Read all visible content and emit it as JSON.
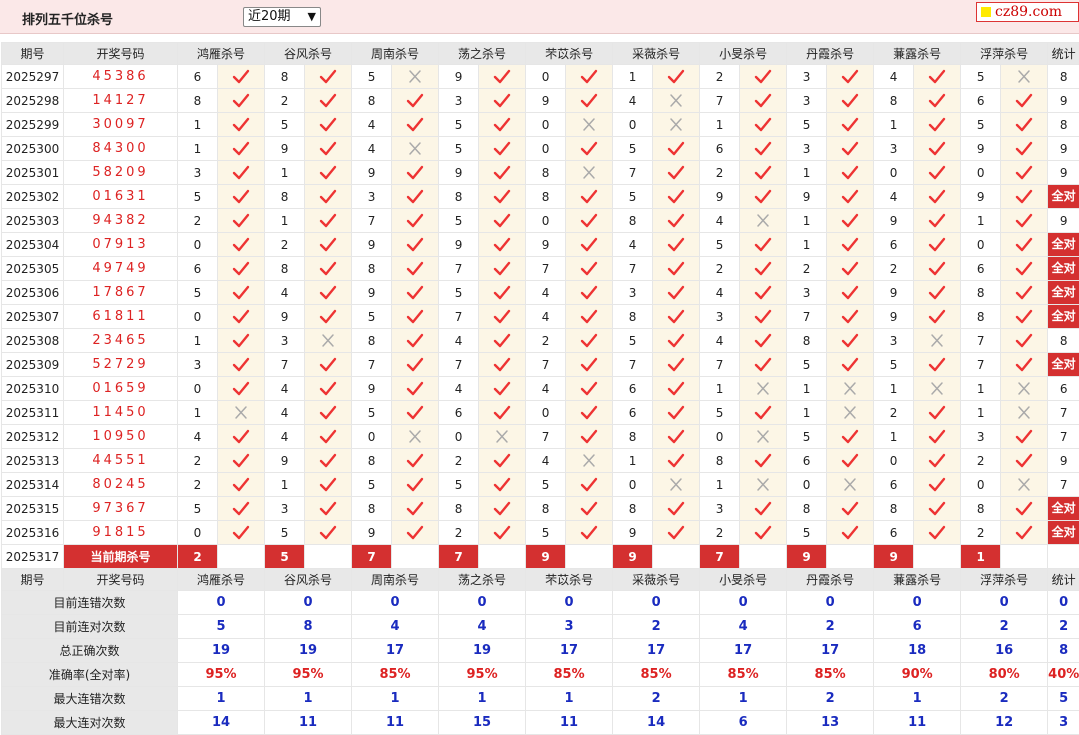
{
  "page_title": "排列五千位杀号",
  "period_select": {
    "value": "近20期",
    "options": [
      "近20期"
    ]
  },
  "logo_text": "cz89.com",
  "headers": [
    "期号",
    "开奖号码",
    "鸿雁杀号",
    "谷风杀号",
    "周南杀号",
    "荡之杀号",
    "芣苡杀号",
    "采薇杀号",
    "小旻杀号",
    "丹霞杀号",
    "蒹露杀号",
    "浮萍杀号",
    "统计"
  ],
  "all_correct_label": "全对",
  "current_label": "当前期杀号",
  "rows": [
    {
      "issue": "2025297",
      "code": "45386",
      "kills": [
        [
          6,
          1
        ],
        [
          8,
          1
        ],
        [
          5,
          0
        ],
        [
          9,
          1
        ],
        [
          0,
          1
        ],
        [
          1,
          1
        ],
        [
          2,
          1
        ],
        [
          3,
          1
        ],
        [
          4,
          1
        ],
        [
          5,
          0
        ]
      ],
      "total": "8"
    },
    {
      "issue": "2025298",
      "code": "14127",
      "kills": [
        [
          8,
          1
        ],
        [
          2,
          1
        ],
        [
          8,
          1
        ],
        [
          3,
          1
        ],
        [
          9,
          1
        ],
        [
          4,
          0
        ],
        [
          7,
          1
        ],
        [
          3,
          1
        ],
        [
          8,
          1
        ],
        [
          6,
          1
        ]
      ],
      "total": "9"
    },
    {
      "issue": "2025299",
      "code": "30097",
      "kills": [
        [
          1,
          1
        ],
        [
          5,
          1
        ],
        [
          4,
          1
        ],
        [
          5,
          1
        ],
        [
          0,
          0
        ],
        [
          0,
          0
        ],
        [
          1,
          1
        ],
        [
          5,
          1
        ],
        [
          1,
          1
        ],
        [
          5,
          1
        ]
      ],
      "total": "8"
    },
    {
      "issue": "2025300",
      "code": "84300",
      "kills": [
        [
          1,
          1
        ],
        [
          9,
          1
        ],
        [
          4,
          0
        ],
        [
          5,
          1
        ],
        [
          0,
          1
        ],
        [
          5,
          1
        ],
        [
          6,
          1
        ],
        [
          3,
          1
        ],
        [
          3,
          1
        ],
        [
          9,
          1
        ]
      ],
      "total": "9"
    },
    {
      "issue": "2025301",
      "code": "58209",
      "kills": [
        [
          3,
          1
        ],
        [
          1,
          1
        ],
        [
          9,
          1
        ],
        [
          9,
          1
        ],
        [
          8,
          0
        ],
        [
          7,
          1
        ],
        [
          2,
          1
        ],
        [
          1,
          1
        ],
        [
          0,
          1
        ],
        [
          0,
          1
        ]
      ],
      "total": "9"
    },
    {
      "issue": "2025302",
      "code": "01631",
      "kills": [
        [
          5,
          1
        ],
        [
          8,
          1
        ],
        [
          3,
          1
        ],
        [
          8,
          1
        ],
        [
          8,
          1
        ],
        [
          5,
          1
        ],
        [
          9,
          1
        ],
        [
          9,
          1
        ],
        [
          4,
          1
        ],
        [
          9,
          1
        ]
      ],
      "total": "全对"
    },
    {
      "issue": "2025303",
      "code": "94382",
      "kills": [
        [
          2,
          1
        ],
        [
          1,
          1
        ],
        [
          7,
          1
        ],
        [
          5,
          1
        ],
        [
          0,
          1
        ],
        [
          8,
          1
        ],
        [
          4,
          0
        ],
        [
          1,
          1
        ],
        [
          9,
          1
        ],
        [
          1,
          1
        ]
      ],
      "total": "9"
    },
    {
      "issue": "2025304",
      "code": "07913",
      "kills": [
        [
          0,
          1
        ],
        [
          2,
          1
        ],
        [
          9,
          1
        ],
        [
          9,
          1
        ],
        [
          9,
          1
        ],
        [
          4,
          1
        ],
        [
          5,
          1
        ],
        [
          1,
          1
        ],
        [
          6,
          1
        ],
        [
          0,
          1
        ]
      ],
      "total": "全对"
    },
    {
      "issue": "2025305",
      "code": "49749",
      "kills": [
        [
          6,
          1
        ],
        [
          8,
          1
        ],
        [
          8,
          1
        ],
        [
          7,
          1
        ],
        [
          7,
          1
        ],
        [
          7,
          1
        ],
        [
          2,
          1
        ],
        [
          2,
          1
        ],
        [
          2,
          1
        ],
        [
          6,
          1
        ]
      ],
      "total": "全对"
    },
    {
      "issue": "2025306",
      "code": "17867",
      "kills": [
        [
          5,
          1
        ],
        [
          4,
          1
        ],
        [
          9,
          1
        ],
        [
          5,
          1
        ],
        [
          4,
          1
        ],
        [
          3,
          1
        ],
        [
          4,
          1
        ],
        [
          3,
          1
        ],
        [
          9,
          1
        ],
        [
          8,
          1
        ]
      ],
      "total": "全对"
    },
    {
      "issue": "2025307",
      "code": "61811",
      "kills": [
        [
          0,
          1
        ],
        [
          9,
          1
        ],
        [
          5,
          1
        ],
        [
          7,
          1
        ],
        [
          4,
          1
        ],
        [
          8,
          1
        ],
        [
          3,
          1
        ],
        [
          7,
          1
        ],
        [
          9,
          1
        ],
        [
          8,
          1
        ]
      ],
      "total": "全对"
    },
    {
      "issue": "2025308",
      "code": "23465",
      "kills": [
        [
          1,
          1
        ],
        [
          3,
          0
        ],
        [
          8,
          1
        ],
        [
          4,
          1
        ],
        [
          2,
          1
        ],
        [
          5,
          1
        ],
        [
          4,
          1
        ],
        [
          8,
          1
        ],
        [
          3,
          0
        ],
        [
          7,
          1
        ]
      ],
      "total": "8"
    },
    {
      "issue": "2025309",
      "code": "52729",
      "kills": [
        [
          3,
          1
        ],
        [
          7,
          1
        ],
        [
          7,
          1
        ],
        [
          7,
          1
        ],
        [
          7,
          1
        ],
        [
          7,
          1
        ],
        [
          7,
          1
        ],
        [
          5,
          1
        ],
        [
          5,
          1
        ],
        [
          7,
          1
        ]
      ],
      "total": "全对"
    },
    {
      "issue": "2025310",
      "code": "01659",
      "kills": [
        [
          0,
          1
        ],
        [
          4,
          1
        ],
        [
          9,
          1
        ],
        [
          4,
          1
        ],
        [
          4,
          1
        ],
        [
          6,
          1
        ],
        [
          1,
          0
        ],
        [
          1,
          0
        ],
        [
          1,
          0
        ],
        [
          1,
          0
        ]
      ],
      "total": "6"
    },
    {
      "issue": "2025311",
      "code": "11450",
      "kills": [
        [
          1,
          0
        ],
        [
          4,
          1
        ],
        [
          5,
          1
        ],
        [
          6,
          1
        ],
        [
          0,
          1
        ],
        [
          6,
          1
        ],
        [
          5,
          1
        ],
        [
          1,
          0
        ],
        [
          2,
          1
        ],
        [
          1,
          0
        ]
      ],
      "total": "7"
    },
    {
      "issue": "2025312",
      "code": "10950",
      "kills": [
        [
          4,
          1
        ],
        [
          4,
          1
        ],
        [
          0,
          0
        ],
        [
          0,
          0
        ],
        [
          7,
          1
        ],
        [
          8,
          1
        ],
        [
          0,
          0
        ],
        [
          5,
          1
        ],
        [
          1,
          1
        ],
        [
          3,
          1
        ]
      ],
      "total": "7"
    },
    {
      "issue": "2025313",
      "code": "44551",
      "kills": [
        [
          2,
          1
        ],
        [
          9,
          1
        ],
        [
          8,
          1
        ],
        [
          2,
          1
        ],
        [
          4,
          0
        ],
        [
          1,
          1
        ],
        [
          8,
          1
        ],
        [
          6,
          1
        ],
        [
          0,
          1
        ],
        [
          2,
          1
        ]
      ],
      "total": "9"
    },
    {
      "issue": "2025314",
      "code": "80245",
      "kills": [
        [
          2,
          1
        ],
        [
          1,
          1
        ],
        [
          5,
          1
        ],
        [
          5,
          1
        ],
        [
          5,
          1
        ],
        [
          0,
          0
        ],
        [
          1,
          0
        ],
        [
          0,
          0
        ],
        [
          6,
          1
        ],
        [
          0,
          0
        ]
      ],
      "total": "7"
    },
    {
      "issue": "2025315",
      "code": "97367",
      "kills": [
        [
          5,
          1
        ],
        [
          3,
          1
        ],
        [
          8,
          1
        ],
        [
          8,
          1
        ],
        [
          8,
          1
        ],
        [
          8,
          1
        ],
        [
          3,
          1
        ],
        [
          8,
          1
        ],
        [
          8,
          1
        ],
        [
          8,
          1
        ]
      ],
      "total": "全对"
    },
    {
      "issue": "2025316",
      "code": "91815",
      "kills": [
        [
          0,
          1
        ],
        [
          5,
          1
        ],
        [
          9,
          1
        ],
        [
          2,
          1
        ],
        [
          5,
          1
        ],
        [
          9,
          1
        ],
        [
          2,
          1
        ],
        [
          5,
          1
        ],
        [
          6,
          1
        ],
        [
          2,
          1
        ]
      ],
      "total": "全对"
    }
  ],
  "current": {
    "issue": "2025317",
    "kills": [
      "2",
      "5",
      "7",
      "7",
      "9",
      "9",
      "7",
      "9",
      "9",
      "1"
    ]
  },
  "stats": [
    {
      "label": "目前连错次数",
      "values": [
        "0",
        "0",
        "0",
        "0",
        "0",
        "0",
        "0",
        "0",
        "0",
        "0",
        "0"
      ],
      "color": "blue"
    },
    {
      "label": "目前连对次数",
      "values": [
        "5",
        "8",
        "4",
        "4",
        "3",
        "2",
        "4",
        "2",
        "6",
        "2",
        "2"
      ],
      "color": "blue"
    },
    {
      "label": "总正确次数",
      "values": [
        "19",
        "19",
        "17",
        "19",
        "17",
        "17",
        "17",
        "17",
        "18",
        "16",
        "8"
      ],
      "color": "blue"
    },
    {
      "label": "准确率(全对率)",
      "values": [
        "95%",
        "95%",
        "85%",
        "95%",
        "85%",
        "85%",
        "85%",
        "85%",
        "90%",
        "80%",
        "40%"
      ],
      "color": "red"
    },
    {
      "label": "最大连错次数",
      "values": [
        "1",
        "1",
        "1",
        "1",
        "1",
        "2",
        "1",
        "2",
        "1",
        "2",
        "5"
      ],
      "color": "blue"
    },
    {
      "label": "最大连对次数",
      "values": [
        "14",
        "11",
        "11",
        "15",
        "11",
        "14",
        "6",
        "13",
        "11",
        "12",
        "3"
      ],
      "color": "blue"
    }
  ]
}
